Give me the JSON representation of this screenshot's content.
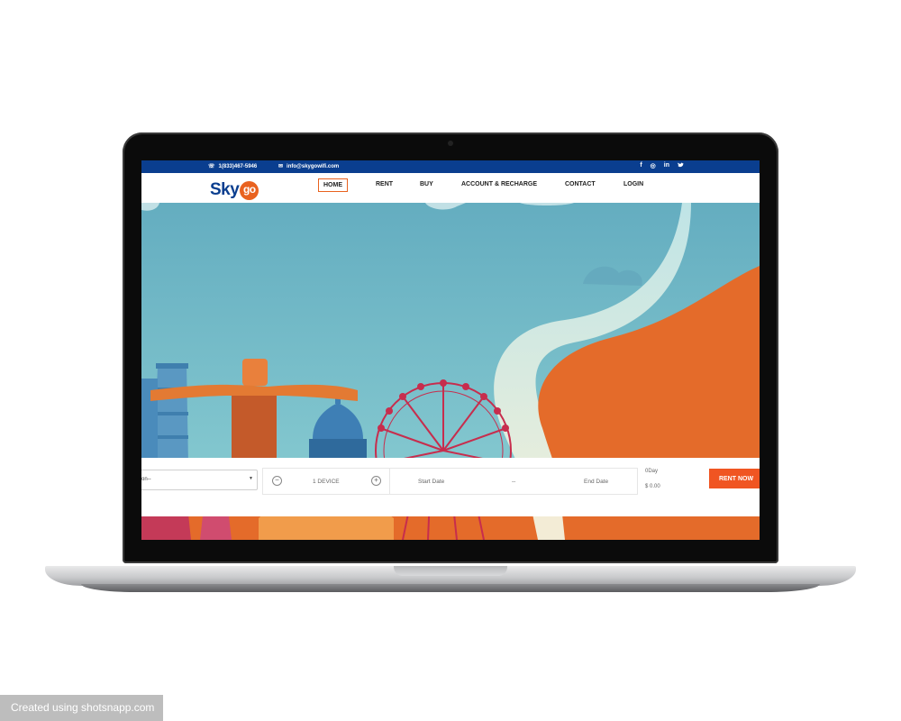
{
  "topbar": {
    "phone": "1(833)467-5946",
    "email": "info@skygowifi.com",
    "social": [
      "f",
      "◎",
      "in",
      "🐦"
    ]
  },
  "logo": {
    "text_sky": "Sky",
    "text_go": "go"
  },
  "nav": [
    {
      "label": "HOME",
      "active": true
    },
    {
      "label": "RENT"
    },
    {
      "label": "BUY"
    },
    {
      "label": "ACCOUNT & RECHARGE"
    },
    {
      "label": "CONTACT"
    },
    {
      "label": "LOGIN"
    }
  ],
  "booking": {
    "destination_value": "on--",
    "device_label": "1 DEVICE",
    "start_date": "Start Date",
    "separator": "--",
    "end_date": "End Date",
    "days": "0Day",
    "price": "$ 0.00",
    "rent_button": "RENT NOW"
  },
  "colors": {
    "topbar": "#0a3e8f",
    "accent": "#e9621f",
    "sky": "#6db7c6"
  },
  "watermark": "Created using shotsnapp.com"
}
